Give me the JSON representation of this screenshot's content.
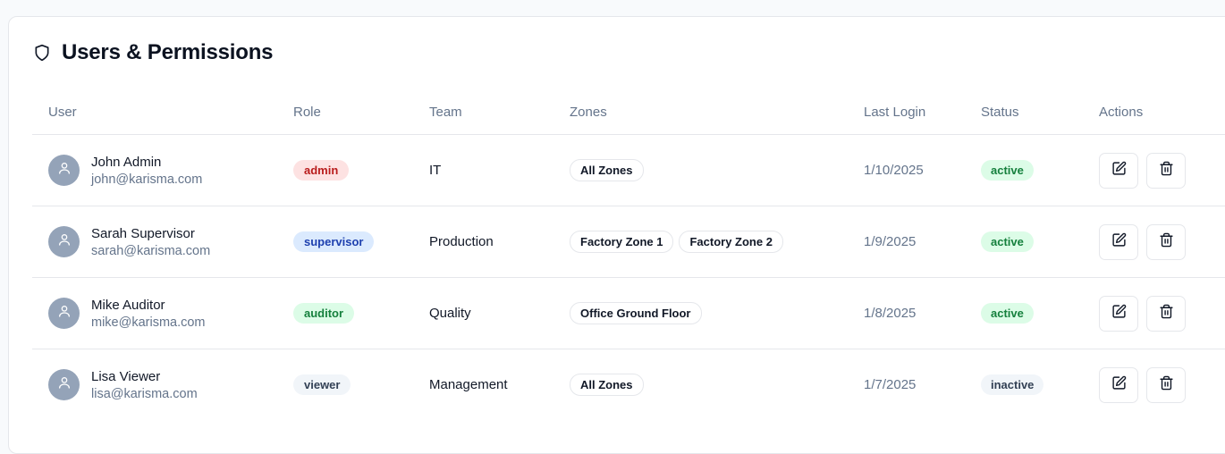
{
  "panel": {
    "title": "Users & Permissions",
    "icon": "shield-icon"
  },
  "columns": {
    "user": "User",
    "role": "Role",
    "team": "Team",
    "zones": "Zones",
    "last_login": "Last Login",
    "status": "Status",
    "actions": "Actions"
  },
  "colors": {
    "admin": {
      "bg": "#fde2e2",
      "fg": "#b91c1c"
    },
    "supervisor": {
      "bg": "#dbeafe",
      "fg": "#1e40af"
    },
    "auditor": {
      "bg": "#dcfce7",
      "fg": "#15803d"
    },
    "viewer": {
      "bg": "#f1f5f9",
      "fg": "#334155"
    },
    "active": {
      "bg": "#dcfce7",
      "fg": "#15803d"
    },
    "inactive": {
      "bg": "#f1f5f9",
      "fg": "#334155"
    }
  },
  "users": [
    {
      "name": "John Admin",
      "email": "john@karisma.com",
      "role": "admin",
      "team": "IT",
      "zones": [
        "All Zones"
      ],
      "last_login": "1/10/2025",
      "status": "active",
      "edit_icon": "edit-icon",
      "delete_icon": "trash-icon"
    },
    {
      "name": "Sarah Supervisor",
      "email": "sarah@karisma.com",
      "role": "supervisor",
      "team": "Production",
      "zones": [
        "Factory Zone 1",
        "Factory Zone 2"
      ],
      "last_login": "1/9/2025",
      "status": "active",
      "edit_icon": "edit-icon",
      "delete_icon": "trash-icon"
    },
    {
      "name": "Mike Auditor",
      "email": "mike@karisma.com",
      "role": "auditor",
      "team": "Quality",
      "zones": [
        "Office Ground Floor"
      ],
      "last_login": "1/8/2025",
      "status": "active",
      "edit_icon": "edit-icon",
      "delete_icon": "trash-icon"
    },
    {
      "name": "Lisa Viewer",
      "email": "lisa@karisma.com",
      "role": "viewer",
      "team": "Management",
      "zones": [
        "All Zones"
      ],
      "last_login": "1/7/2025",
      "status": "inactive",
      "edit_icon": "edit-icon",
      "delete_icon": "trash-icon"
    }
  ]
}
